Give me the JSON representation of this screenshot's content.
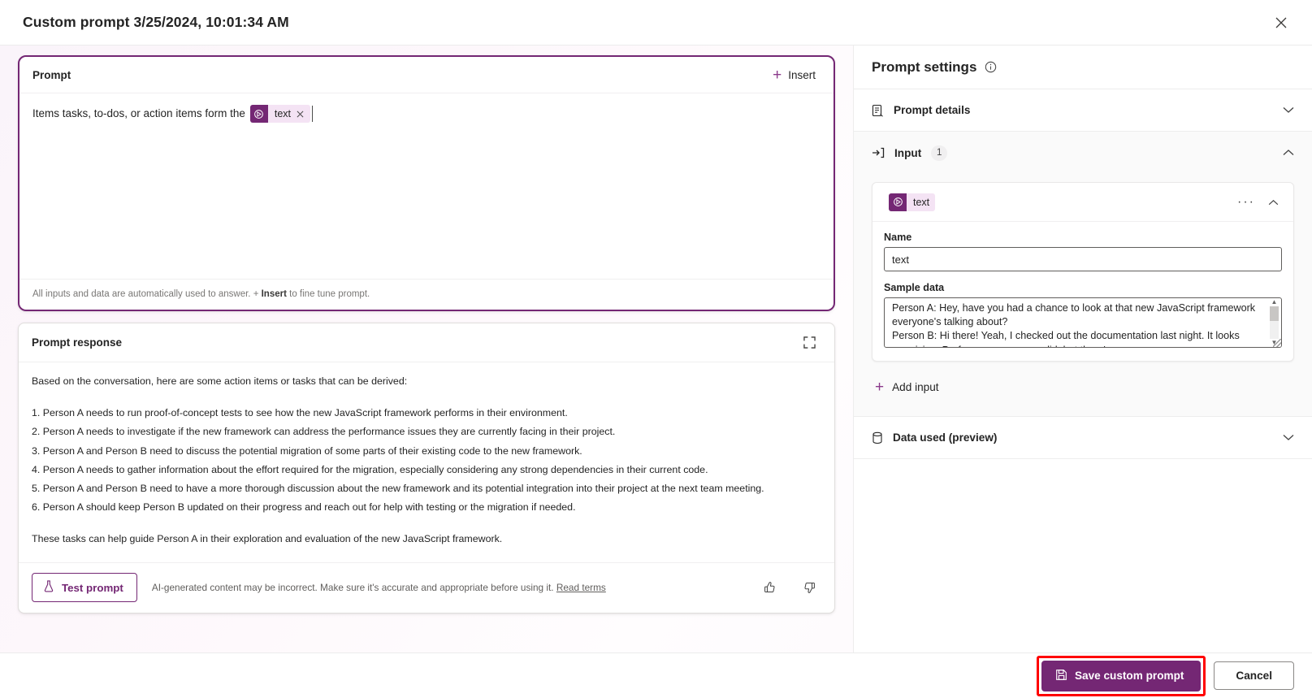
{
  "window": {
    "title": "Custom prompt 3/25/2024, 10:01:34 AM",
    "close_icon": "close-icon"
  },
  "prompt_card": {
    "heading": "Prompt",
    "insert_label": "Insert",
    "insert_icon": "plus-icon",
    "text": "Items tasks, to-dos, or action items form the",
    "chip": {
      "label": "text",
      "icon": "input-token-icon",
      "remove_icon": "close-icon"
    },
    "footer_prefix": "All inputs and data are automatically used to answer. + ",
    "footer_bold": "Insert",
    "footer_suffix": " to fine tune prompt."
  },
  "response_card": {
    "heading": "Prompt response",
    "expand_icon": "expand-icon",
    "lede": "Based on the conversation, here are some action items or tasks that can be derived:",
    "items": [
      "1. Person A needs to run proof-of-concept tests to see how the new JavaScript framework performs in their environment.",
      "2. Person A needs to investigate if the new framework can address the performance issues they are currently facing in their project.",
      "3. Person A and Person B need to discuss the potential migration of some parts of their existing code to the new framework.",
      "4. Person A needs to gather information about the effort required for the migration, especially considering any strong dependencies in their current code.",
      "5. Person A and Person B need to have a more thorough discussion about the new framework and its potential integration into their project at the next team meeting.",
      "6. Person A should keep Person B updated on their progress and reach out for help with testing or the migration if needed."
    ],
    "closing": "These tasks can help guide Person A in their exploration and evaluation of the new JavaScript framework.",
    "test_button": "Test prompt",
    "test_button_icon": "flask-icon",
    "disclaimer": "AI-generated content may be incorrect. Make sure it's accurate and appropriate before using it.",
    "disclaimer_link": "Read terms",
    "thumbs_up_icon": "thumbs-up-icon",
    "thumbs_down_icon": "thumbs-down-icon"
  },
  "settings": {
    "title": "Prompt settings",
    "info_icon": "info-icon",
    "prompt_details": {
      "label": "Prompt details",
      "icon": "document-icon",
      "chevron": "chevron-down-icon"
    },
    "input_section": {
      "label": "Input",
      "count": "1",
      "icon": "arrow-into-icon",
      "chevron": "chevron-up-icon"
    },
    "input_card": {
      "chip_label": "text",
      "chip_icon": "input-token-icon",
      "more_icon": "ellipsis-icon",
      "collapse_icon": "chevron-up-icon",
      "name_label": "Name",
      "name_value": "text",
      "sample_label": "Sample data",
      "sample_value": "Person A: Hey, have you had a chance to look at that new JavaScript framework everyone's talking about?\nPerson B: Hi there! Yeah, I checked out the documentation last night. It looks promising. Performance seems solid, but there's"
    },
    "add_input": {
      "label": "Add input",
      "icon": "plus-icon"
    },
    "data_used": {
      "label": "Data used (preview)",
      "icon": "database-icon",
      "chevron": "chevron-down-icon"
    }
  },
  "footer": {
    "save_label": "Save custom prompt",
    "save_icon": "save-icon",
    "cancel_label": "Cancel",
    "highlight_color": "#ff0000"
  },
  "colors": {
    "accent": "#742774",
    "chip_bg": "#f4e3f4",
    "page_bg": "#faf4fa"
  }
}
